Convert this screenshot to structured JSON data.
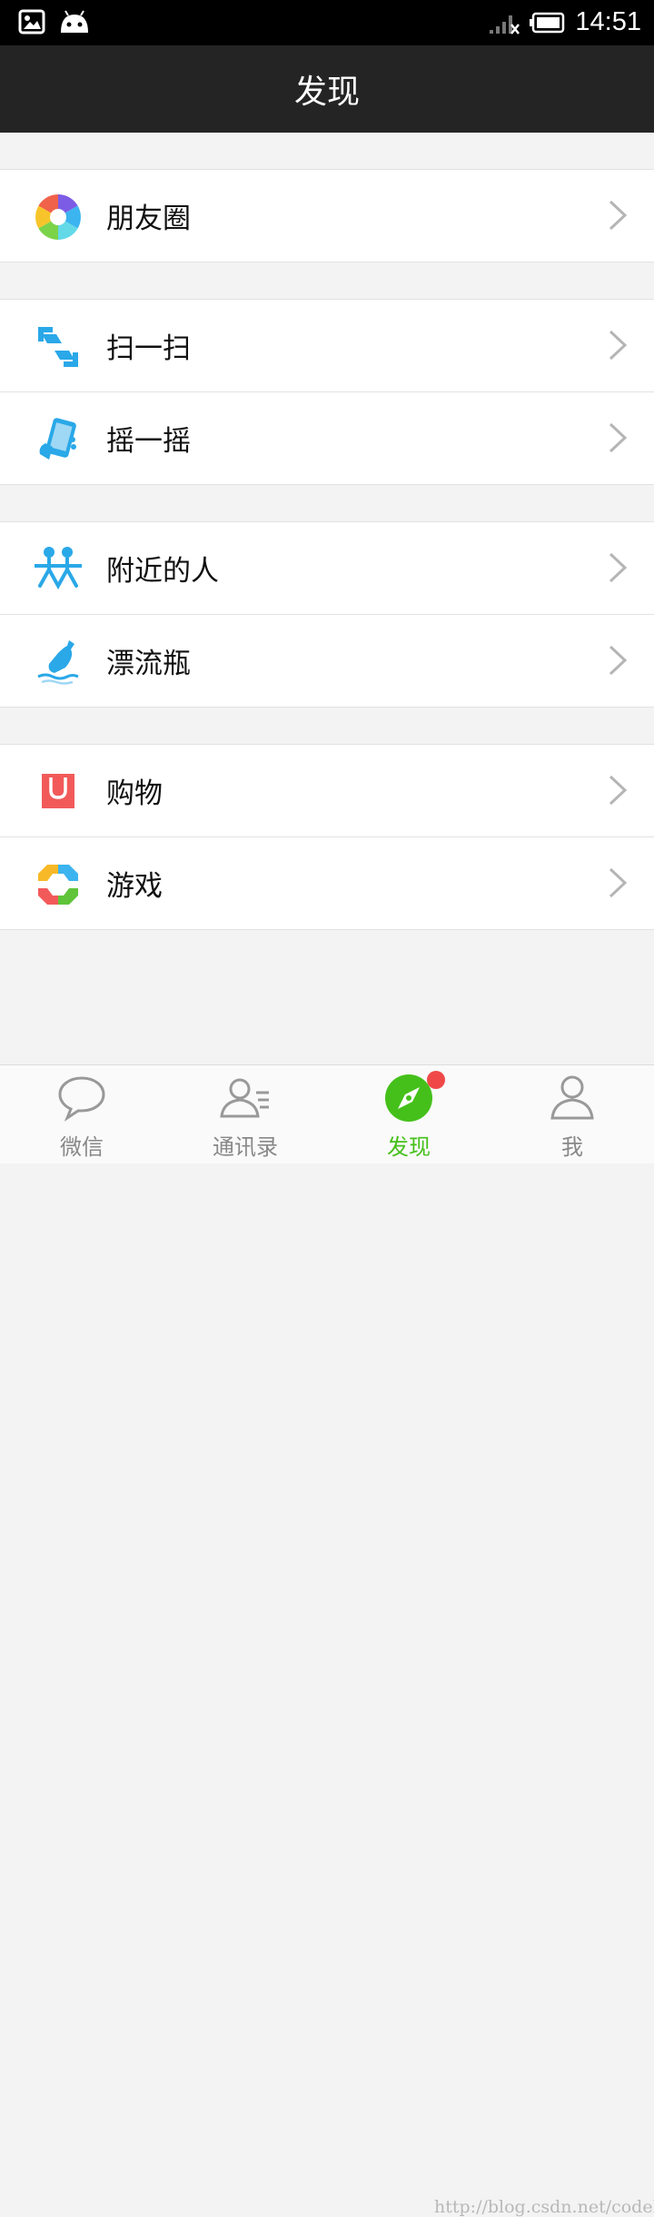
{
  "status_bar": {
    "time": "14:51"
  },
  "header": {
    "title": "发现"
  },
  "groups": [
    {
      "items": [
        {
          "label": "朋友圈",
          "icon": "moments-icon"
        }
      ]
    },
    {
      "items": [
        {
          "label": "扫一扫",
          "icon": "scan-icon"
        },
        {
          "label": "摇一摇",
          "icon": "shake-icon"
        }
      ]
    },
    {
      "items": [
        {
          "label": "附近的人",
          "icon": "people-nearby-icon"
        },
        {
          "label": "漂流瓶",
          "icon": "drift-bottle-icon"
        }
      ]
    },
    {
      "items": [
        {
          "label": "购物",
          "icon": "shopping-icon"
        },
        {
          "label": "游戏",
          "icon": "games-icon"
        }
      ]
    }
  ],
  "tabs": [
    {
      "label": "微信",
      "icon": "chat-bubble-icon"
    },
    {
      "label": "通讯录",
      "icon": "contacts-icon"
    },
    {
      "label": "发现",
      "icon": "compass-icon",
      "active": true,
      "badge": true
    },
    {
      "label": "我",
      "icon": "person-icon"
    }
  ],
  "watermark": "http://blog.csdn.net/codehxy",
  "colors": {
    "accent": "#45c01a",
    "header_bg": "#242424",
    "badge": "#f04848"
  }
}
